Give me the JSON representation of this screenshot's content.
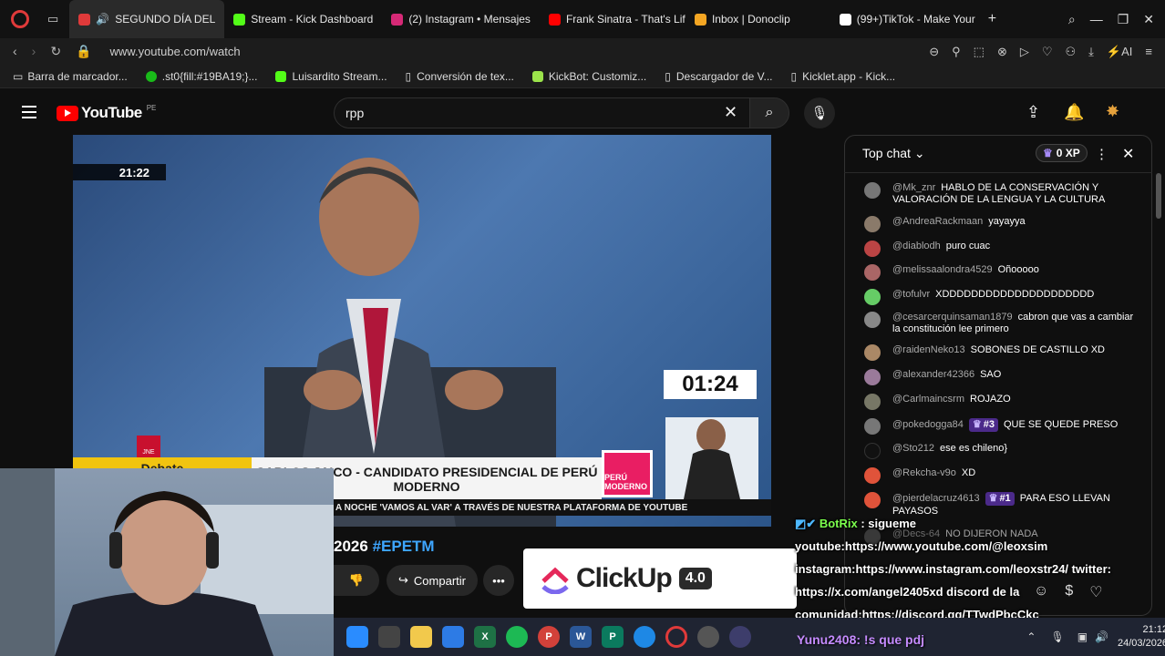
{
  "browser": {
    "tabs": [
      {
        "label": "SEGUNDO DÍA DEL",
        "color": "#e03a3a",
        "active": true
      },
      {
        "label": "Stream - Kick Dashboard",
        "color": "#53fc18"
      },
      {
        "label": "(2) Instagram • Mensajes",
        "color": "#d62976"
      },
      {
        "label": "Frank Sinatra - That's Life",
        "color": "#ff0000"
      },
      {
        "label": "Inbox | Donoclip",
        "color": "#f4a623"
      },
      {
        "label": "(99+)TikTok - Make Your",
        "color": "#ffffff"
      }
    ],
    "new_tab": "+",
    "url": "www.youtube.com/watch",
    "ai_label": "AI",
    "bookmarks": [
      {
        "label": "Barra de marcador...",
        "color": "#bbbbbb"
      },
      {
        "label": ".st0{fill:#19BA19;}...",
        "color": "#19ba19"
      },
      {
        "label": "Luisardito Stream...",
        "color": "#53fc18"
      },
      {
        "label": "Conversión de tex...",
        "color": "#cccccc"
      },
      {
        "label": "KickBot: Customiz...",
        "color": "#9be34b"
      },
      {
        "label": "Descargador de V...",
        "color": "#cccccc"
      },
      {
        "label": "Kicklet.app - Kick...",
        "color": "#cccccc"
      }
    ]
  },
  "youtube": {
    "logo_text": "YouTube",
    "region": "PE",
    "search_value": "rpp",
    "video": {
      "timestamp": "21:22",
      "countdown": "01:24",
      "jne": "JNE",
      "debate": "Debate",
      "lower_third": "CARLOS JAICO - CANDIDATO PRESIDENCIAL DE PERÚ MODERNO",
      "party": "PERÚ MODERNO",
      "ticker": "A NOCHE 'VAMOS AL VAR' A TRAVÉS DE NUESTRA PLATAFORMA DE YOUTUBE"
    },
    "title_partial": "2026",
    "hashtag": "#EPETM",
    "share_label": "Compartir",
    "ad": {
      "brand": "ClickUp",
      "version": "4.0"
    }
  },
  "chat": {
    "header": "Top chat",
    "xp": "0 XP",
    "messages": [
      {
        "author": "@Mk_znr",
        "text": "HABLO DE LA CONSERVACIÓN Y VALORACIÓN DE LA LENGUA Y LA CULTURA",
        "color": "#777777"
      },
      {
        "author": "@AndreaRackmaan",
        "text": "yayayya",
        "color": "#8a7a6a"
      },
      {
        "author": "@diablodh",
        "text": "puro cuac",
        "color": "#b44"
      },
      {
        "author": "@melissaalondra4529",
        "text": "Oñooooo",
        "color": "#a66"
      },
      {
        "author": "@tofulvr",
        "text": "XDDDDDDDDDDDDDDDDDDDDD",
        "color": "#6c6"
      },
      {
        "author": "@cesarcerquinsaman1879",
        "text": "cabron que vas a cambiar la constitución lee primero",
        "color": "#888"
      },
      {
        "author": "@raidenNeko13",
        "text": "SOBONES DE CASTILLO XD",
        "color": "#a86"
      },
      {
        "author": "@alexander42366",
        "text": "SAO",
        "color": "#9a7a9a"
      },
      {
        "author": "@Carlmaincsrm",
        "text": "ROJAZO",
        "color": "#776"
      },
      {
        "author": "@pokedogga84",
        "badge": "#3",
        "text": "QUE SE QUEDE PRESO",
        "color": "#777"
      },
      {
        "author": "@Sto212",
        "text": "ese es chileno}",
        "color": "#111"
      },
      {
        "author": "@Rekcha-v9o",
        "text": "XD",
        "color": "#e0533a"
      },
      {
        "author": "@pierdelacruz4613",
        "badge": "#1",
        "text": "PARA ESO LLEVAN PAYASOS",
        "color": "#e0533a"
      },
      {
        "author": "@Decs-64",
        "text": "NO DIJERON NADA",
        "color": "#555"
      }
    ],
    "overlay": {
      "bot": "BotRix",
      "lines": [
        ": sigueme",
        "youtube:https://www.youtube.com/@leoxsim",
        "instagram:https://www.instagram.com/leoxstr24/ twitter:",
        "https://x.com/angel2405xd discord de la",
        "comunidad:https://discord.gg/TTwdPbcCkc"
      ],
      "user": "Yunu2408",
      "user_text": ": !s que pdj"
    }
  },
  "taskbar": {
    "time": "21:12",
    "date": "24/03/2026"
  }
}
